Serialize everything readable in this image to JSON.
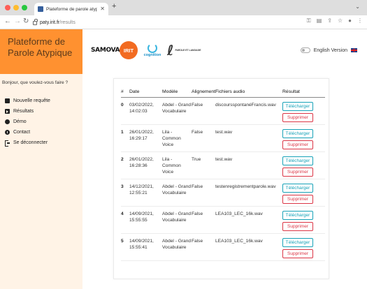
{
  "browser": {
    "tab_title": "Plateforme de parole atypique",
    "url_host": "paty.irit.fr",
    "url_path": "/results"
  },
  "sidebar": {
    "title": "Plateforme de Parole Atypique",
    "greeting": "Bonjour, que voulez-vous faire ?",
    "items": [
      {
        "label": "Nouvelle requête",
        "icon": "file-icon"
      },
      {
        "label": "Résultats",
        "icon": "results-icon"
      },
      {
        "label": "Démo",
        "icon": "dashboard-icon"
      },
      {
        "label": "Contact",
        "icon": "info-icon"
      },
      {
        "label": "Se déconnecter",
        "icon": "logout-icon"
      }
    ]
  },
  "header": {
    "logos": {
      "samova": "SAMOVA",
      "irit": "IRIT",
      "cognition": "cognition",
      "pl": "PAROLE ET LANGAGE"
    },
    "language_label": "English Version"
  },
  "table": {
    "headers": [
      "#",
      "Date",
      "Modèle",
      "Alignement",
      "Fichiers audio",
      "Résultat"
    ],
    "download_label": "Télécharger",
    "delete_label": "Supprimer",
    "rows": [
      {
        "num": "0",
        "date": "03/02/2022, 14:02:03",
        "model": "Abdel - Grand Vocabulaire",
        "alignment": "False",
        "file": "discoursspontanéFrancis.wav"
      },
      {
        "num": "1",
        "date": "26/01/2022, 16:29:17",
        "model": "Lila - Common Voice",
        "alignment": "False",
        "file": "test.wav"
      },
      {
        "num": "2",
        "date": "26/01/2022, 16:28:36",
        "model": "Lila - Common Voice",
        "alignment": "True",
        "file": "test.wav"
      },
      {
        "num": "3",
        "date": "14/12/2021, 12:55:21",
        "model": "Abdel - Grand Vocabulaire",
        "alignment": "False",
        "file": "testenregistrementparole.wav"
      },
      {
        "num": "4",
        "date": "14/09/2021, 15:55:55",
        "model": "Abdel - Grand Vocabulaire",
        "alignment": "False",
        "file": "LEA103_LEC_16k.wav"
      },
      {
        "num": "5",
        "date": "14/09/2021, 15:55:41",
        "model": "Abdel - Grand Vocabulaire",
        "alignment": "False",
        "file": "LEA103_LEC_16k.wav"
      }
    ]
  },
  "colors": {
    "brand_orange": "#ff9130",
    "sidebar_bg": "#fff3e6",
    "download": "#17a2b8",
    "delete": "#dc3545"
  }
}
